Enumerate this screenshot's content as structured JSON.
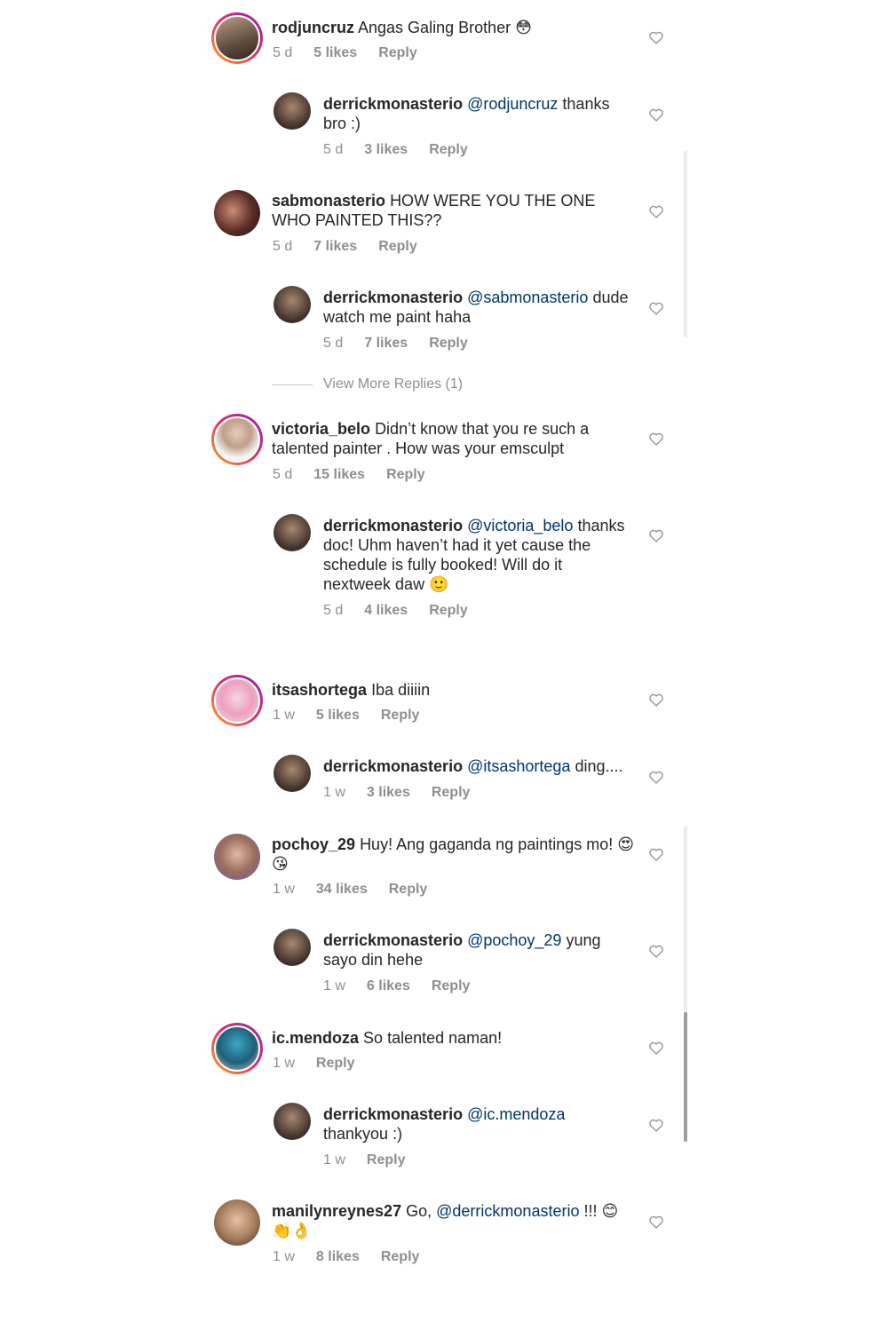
{
  "colors": {
    "text": "#262626",
    "meta": "#8e8e8e",
    "mention": "#003569",
    "story_ring": "#e1306c"
  },
  "comments": [
    {
      "user": "rodjuncruz",
      "text": "Angas Galing Brother",
      "emoji_end": "😳",
      "time": "5 d",
      "likes": "5 likes",
      "reply": "Reply"
    },
    {
      "user": "derrickmonasterio",
      "mention": "@rodjuncruz",
      "text": "thanks bro :)",
      "time": "5 d",
      "likes": "3 likes",
      "reply": "Reply"
    },
    {
      "user": "sabmonasterio",
      "text": "HOW WERE YOU THE ONE WHO PAINTED THIS??",
      "time": "5 d",
      "likes": "7 likes",
      "reply": "Reply"
    },
    {
      "user": "derrickmonasterio",
      "mention": "@sabmonasterio",
      "text": "dude watch me paint haha",
      "time": "5 d",
      "likes": "7 likes",
      "reply": "Reply"
    },
    {
      "user": "victoria_belo",
      "text": "Didn’t know that you re such a talented painter .  How was your emsculpt",
      "time": "5 d",
      "likes": "15 likes",
      "reply": "Reply"
    },
    {
      "user": "derrickmonasterio",
      "mention": "@victoria_belo",
      "text": "thanks doc! Uhm haven’t had it yet cause the schedule is fully booked! Will do it nextweek daw",
      "emoji_end": "🙂",
      "time": "5 d",
      "likes": "4 likes",
      "reply": "Reply"
    },
    {
      "user": "itsashortega",
      "text": "Iba diiiin",
      "time": "1 w",
      "likes": "5 likes",
      "reply": "Reply"
    },
    {
      "user": "derrickmonasterio",
      "mention": "@itsashortega",
      "text": "ding....",
      "time": "1 w",
      "likes": "3 likes",
      "reply": "Reply"
    },
    {
      "user": "pochoy_29",
      "text": "Huy! Ang gaganda ng paintings mo!",
      "emoji_end": "😍😘",
      "time": "1 w",
      "likes": "34 likes",
      "reply": "Reply"
    },
    {
      "user": "derrickmonasterio",
      "mention": "@pochoy_29",
      "text": "yung sayo din hehe",
      "time": "1 w",
      "likes": "6 likes",
      "reply": "Reply"
    },
    {
      "user": "ic.mendoza",
      "text": "So talented naman!",
      "time": "1 w",
      "reply": "Reply"
    },
    {
      "user": "derrickmonasterio",
      "mention": "@ic.mendoza",
      "text": "thankyou :)",
      "time": "1 w",
      "reply": "Reply"
    },
    {
      "user": "manilynreynes27",
      "text": "Go,",
      "mention_after": "@derrickmonasterio",
      "text_after": "!!!",
      "emoji_end": "😊👏👌",
      "time": "1 w",
      "likes": "8 likes",
      "reply": "Reply"
    }
  ],
  "view_more": "View More Replies (1)",
  "icons": {
    "like": "heart-outline-icon"
  }
}
